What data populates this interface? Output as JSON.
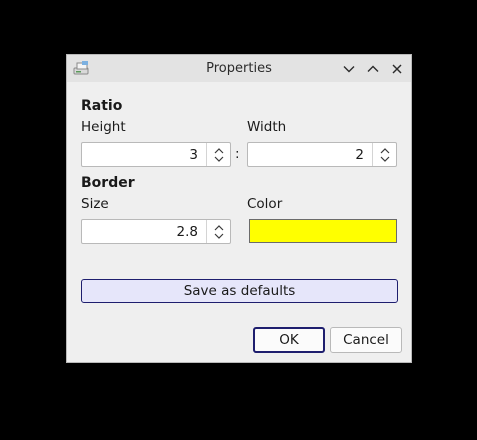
{
  "window": {
    "title": "Properties"
  },
  "titlebar": {
    "icons": [
      "app-icon",
      "chevron-down-icon",
      "chevron-up-icon",
      "close-icon"
    ]
  },
  "ratio": {
    "section_title": "Ratio",
    "height_label": "Height",
    "height_value": "3",
    "separator": ":",
    "width_label": "Width",
    "width_value": "2"
  },
  "border": {
    "section_title": "Border",
    "size_label": "Size",
    "size_value": "2.8",
    "color_label": "Color",
    "color_value": "#ffff00"
  },
  "actions": {
    "save_defaults_label": "Save as defaults",
    "ok_label": "OK",
    "cancel_label": "Cancel"
  },
  "colors": {
    "accent_border": "#1e1e6e",
    "save_button_bg": "#e6e6fa"
  }
}
